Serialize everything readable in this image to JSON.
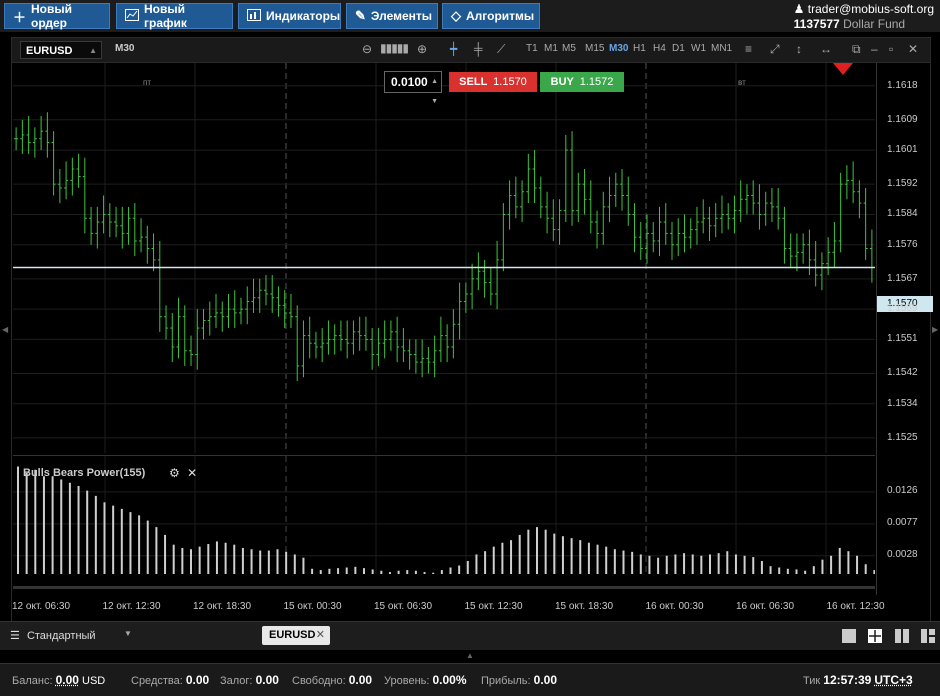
{
  "toolbar": {
    "new_order": "Новый ордер",
    "new_chart": "Новый график",
    "indicators": "Индикаторы",
    "elements": "Элементы",
    "algorithms": "Алгоритмы"
  },
  "account": {
    "user": "trader@mobius-soft.org",
    "number": "1137577",
    "fund": "Dollar Fund"
  },
  "chart": {
    "symbol": "EURUSD",
    "period": "M30",
    "timeframes": [
      "T1",
      "M1",
      "M5",
      "M15",
      "M30",
      "H1",
      "H4",
      "D1",
      "W1",
      "MN1"
    ],
    "active_timeframe": "M30",
    "lot": "0.0100",
    "sell_label": "SELL",
    "sell_price": "1.1570",
    "buy_label": "BUY",
    "buy_price": "1.1572",
    "current_price": "1.1570",
    "day_labels": [
      "пт",
      "вт"
    ],
    "indicator_title": "Bulls Bears Power(155)"
  },
  "chart_data": [
    {
      "type": "candlestick",
      "title": "",
      "y_ticks": [
        "1.1618",
        "1.1609",
        "1.1601",
        "1.1592",
        "1.1584",
        "1.1576",
        "1.1567",
        "1.1559",
        "1.1551",
        "1.1542",
        "1.1534",
        "1.1525"
      ],
      "ylim": [
        1.1521,
        1.1624
      ],
      "x_ticks": [
        "12 окт. 06:30",
        "12 окт. 12:30",
        "12 окт. 18:30",
        "15 окт. 00:30",
        "15 окт. 06:30",
        "15 окт. 12:30",
        "15 окт. 18:30",
        "16 окт. 00:30",
        "16 окт. 06:30",
        "16 окт. 12:30"
      ],
      "close": [
        1.1604,
        1.1605,
        1.1603,
        1.1604,
        1.1606,
        1.1603,
        1.1592,
        1.1591,
        1.1593,
        1.1596,
        1.1594,
        1.1583,
        1.1579,
        1.1582,
        1.1584,
        1.1582,
        1.1581,
        1.1579,
        1.1583,
        1.1577,
        1.1578,
        1.1575,
        1.1572,
        1.1557,
        1.1554,
        1.1549,
        1.1557,
        1.1548,
        1.1547,
        1.1554,
        1.1556,
        1.1557,
        1.1558,
        1.1557,
        1.1559,
        1.1558,
        1.1559,
        1.1561,
        1.1562,
        1.1564,
        1.1563,
        1.1562,
        1.156,
        1.1558,
        1.1557,
        1.1544,
        1.1552,
        1.155,
        1.1549,
        1.155,
        1.1551,
        1.1552,
        1.1551,
        1.155,
        1.1553,
        1.1552,
        1.1551,
        1.1547,
        1.155,
        1.1551,
        1.1553,
        1.1549,
        1.1548,
        1.1547,
        1.1545,
        1.1546,
        1.1545,
        1.1548,
        1.1552,
        1.1549,
        1.1555,
        1.1561,
        1.1563,
        1.1567,
        1.1569,
        1.1566,
        1.1563,
        1.1572,
        1.1584,
        1.1589,
        1.1586,
        1.159,
        1.1596,
        1.1591,
        1.1586,
        1.1583,
        1.158,
        1.1585,
        1.1601,
        1.1585,
        1.1592,
        1.1588,
        1.1582,
        1.1579,
        1.1586,
        1.1589,
        1.1592,
        1.1589,
        1.1584,
        1.1578,
        1.1575,
        1.1579,
        1.1577,
        1.1582,
        1.1579,
        1.1576,
        1.1579,
        1.1578,
        1.158,
        1.1582,
        1.1583,
        1.1581,
        1.1583,
        1.1584,
        1.1583,
        1.1585,
        1.1588,
        1.1589,
        1.1587,
        1.1584,
        1.1587,
        1.1586,
        1.1583,
        1.1575,
        1.1573,
        1.1574,
        1.1576,
        1.1572,
        1.1568,
        1.1571,
        1.1574,
        1.1577,
        1.1592,
        1.1593,
        1.159,
        1.1587,
        1.1575,
        1.157
      ],
      "series": [
        {
          "name": "EURUSD"
        }
      ]
    },
    {
      "type": "bar",
      "title": "Bulls Bears Power(155)",
      "y_ticks": [
        "0.0126",
        "0.0077",
        "0.0028"
      ],
      "ylim": [
        0,
        0.0175
      ],
      "values": [
        0.0165,
        0.0155,
        0.016,
        0.015,
        0.015,
        0.0145,
        0.014,
        0.0135,
        0.0128,
        0.012,
        0.011,
        0.0105,
        0.01,
        0.0095,
        0.009,
        0.0082,
        0.0072,
        0.006,
        0.0045,
        0.004,
        0.0038,
        0.0042,
        0.0046,
        0.005,
        0.0048,
        0.0045,
        0.004,
        0.0038,
        0.0036,
        0.0036,
        0.0038,
        0.0034,
        0.003,
        0.0025,
        0.0008,
        0.0006,
        0.0008,
        0.0009,
        0.001,
        0.0011,
        0.0009,
        0.0007,
        0.0005,
        0.0003,
        0.0005,
        0.0006,
        0.0005,
        0.0003,
        0.0002,
        0.0006,
        0.001,
        0.0013,
        0.002,
        0.003,
        0.0035,
        0.0042,
        0.0048,
        0.0052,
        0.006,
        0.0068,
        0.0072,
        0.0068,
        0.0062,
        0.0058,
        0.0055,
        0.0052,
        0.0048,
        0.0045,
        0.0042,
        0.0038,
        0.0036,
        0.0034,
        0.003,
        0.0028,
        0.0025,
        0.0028,
        0.003,
        0.0032,
        0.003,
        0.0028,
        0.003,
        0.0032,
        0.0035,
        0.003,
        0.0028,
        0.0026,
        0.002,
        0.0012,
        0.001,
        0.0008,
        0.0007,
        0.0005,
        0.0012,
        0.0022,
        0.0028,
        0.004,
        0.0035,
        0.0028,
        0.0015,
        0.0006
      ]
    }
  ],
  "bottom": {
    "profile": "Стандартный",
    "tab": "EURUSD"
  },
  "status": {
    "balance_label": "Баланс:",
    "balance_value": "0.00",
    "balance_ccy": "USD",
    "equity_label": "Средства:",
    "equity_value": "0.00",
    "margin_label": "Залог:",
    "margin_value": "0.00",
    "free_label": "Свободно:",
    "free_value": "0.00",
    "level_label": "Уровень:",
    "level_value": "0.00%",
    "profit_label": "Прибыль:",
    "profit_value": "0.00",
    "tick_label": "Тик",
    "time": "12:57:39",
    "tz": "UTC+3"
  },
  "colors": {
    "candle": "#3ec43e",
    "button": "#1f5a94",
    "sell": "#d9322e",
    "buy": "#3aa84a"
  }
}
